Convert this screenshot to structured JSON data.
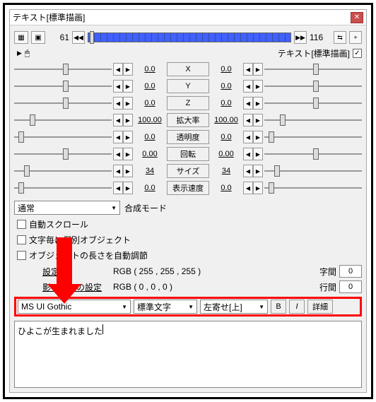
{
  "window": {
    "title": "テキスト[標準描画]"
  },
  "timeline": {
    "start_frame": "61",
    "end_frame": "116",
    "layer_name": "テキスト[標準描画]",
    "layer_checked": true
  },
  "props": [
    {
      "name": "X",
      "left_val": "0.0",
      "right_val": "0.0",
      "left_thumb": 50,
      "right_thumb": 50
    },
    {
      "name": "Y",
      "left_val": "0.0",
      "right_val": "0.0",
      "left_thumb": 50,
      "right_thumb": 50
    },
    {
      "name": "Z",
      "left_val": "0.0",
      "right_val": "0.0",
      "left_thumb": 50,
      "right_thumb": 50
    },
    {
      "name": "拡大率",
      "left_val": "100.00",
      "right_val": "100.00",
      "left_thumb": 16,
      "right_thumb": 16
    },
    {
      "name": "透明度",
      "left_val": "0.0",
      "right_val": "0.0",
      "left_thumb": 4,
      "right_thumb": 4
    },
    {
      "name": "回転",
      "left_val": "0.00",
      "right_val": "0.00",
      "left_thumb": 50,
      "right_thumb": 50
    },
    {
      "name": "サイズ",
      "left_val": "34",
      "right_val": "34",
      "left_thumb": 10,
      "right_thumb": 10
    },
    {
      "name": "表示速度",
      "left_val": "0.0",
      "right_val": "0.0",
      "left_thumb": 4,
      "right_thumb": 4
    }
  ],
  "blend": {
    "label": "合成モード",
    "value": "通常"
  },
  "checks": {
    "auto_scroll": "自動スクロール",
    "per_char": "文字毎に個別オブジェクト",
    "auto_adjust": "オブジェクトの長さを自動調節"
  },
  "color": {
    "label": "設定",
    "rgb": "RGB ( 255 , 255 , 255 )"
  },
  "shadow": {
    "label": "影・縁色の設定",
    "rgb": "RGB ( 0 , 0 , 0 )"
  },
  "spacing": {
    "char_label": "字間",
    "char_val": "0",
    "line_label": "行間",
    "line_val": "0"
  },
  "font": {
    "family": "MS UI Gothic",
    "decor": "標準文字",
    "align": "左寄せ[上]",
    "bold": "B",
    "italic": "I",
    "details": "詳細"
  },
  "text": "ひよこが生まれました"
}
